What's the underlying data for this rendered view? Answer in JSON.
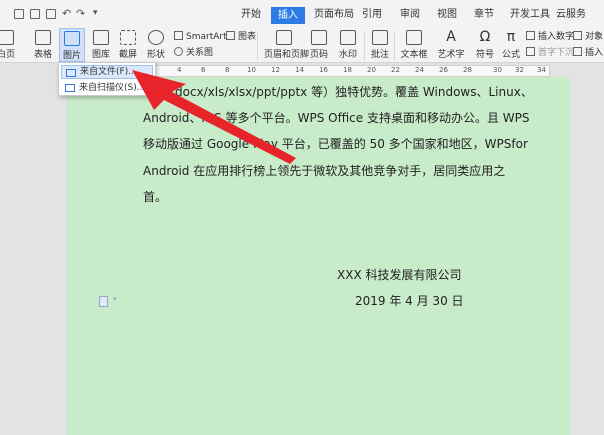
{
  "menubar": {
    "tabs": [
      "开始",
      "插入",
      "页面布局",
      "引用",
      "审阅",
      "视图",
      "章节",
      "开发工具",
      "云服务"
    ],
    "active_tab": "插入"
  },
  "ribbon": {
    "page_label": "白页",
    "table_label": "表格",
    "picture_label": "图片",
    "screenshot_gallery_label": "图库",
    "screenshot_label": "截屏",
    "shape_label": "形状",
    "smartart_label": "SmartArt",
    "chart_label": "图表",
    "relation_label": "关系图",
    "header_footer_label": "页眉和页脚",
    "page_number_label": "页码",
    "watermark_label": "水印",
    "comment_label": "批注",
    "textbox_label": "文本框",
    "wordart_label": "艺术字",
    "symbol_label": "符号",
    "formula_label": "公式",
    "insert_number_label": "插入数字",
    "object_label": "对象",
    "drop_cap_label": "首字下沉",
    "insert_label": "插入"
  },
  "dropdown": {
    "items": [
      "来自文件(F)...",
      "来自扫描仪(S)..."
    ]
  },
  "ruler": {
    "numbers": [
      "4",
      "6",
      "8",
      "10",
      "12",
      "14",
      "16",
      "18",
      "20",
      "22",
      "24",
      "26",
      "28",
      "30",
      "32",
      "34"
    ]
  },
  "document": {
    "lines": [
      "docx/xls/xlsx/ppt/pptx 等）独特优势。覆盖 Windows、Linux、",
      "Android、iOS 等多个平台。WPS Office 支持桌面和移动办公。且 WPS",
      "移动版通过 Google Play 平台，已覆盖的 50 多个国家和地区，WPSfor",
      "Android 在应用排行榜上领先于微软及其他竞争对手，居同类应用之",
      "首。"
    ],
    "company": "XXX 科技发展有限公司",
    "date": "2019 年 4 月 30 日"
  },
  "colors": {
    "page_background": "#c8ebca",
    "accent": "#2d7be5",
    "arrow": "#e8242b"
  }
}
